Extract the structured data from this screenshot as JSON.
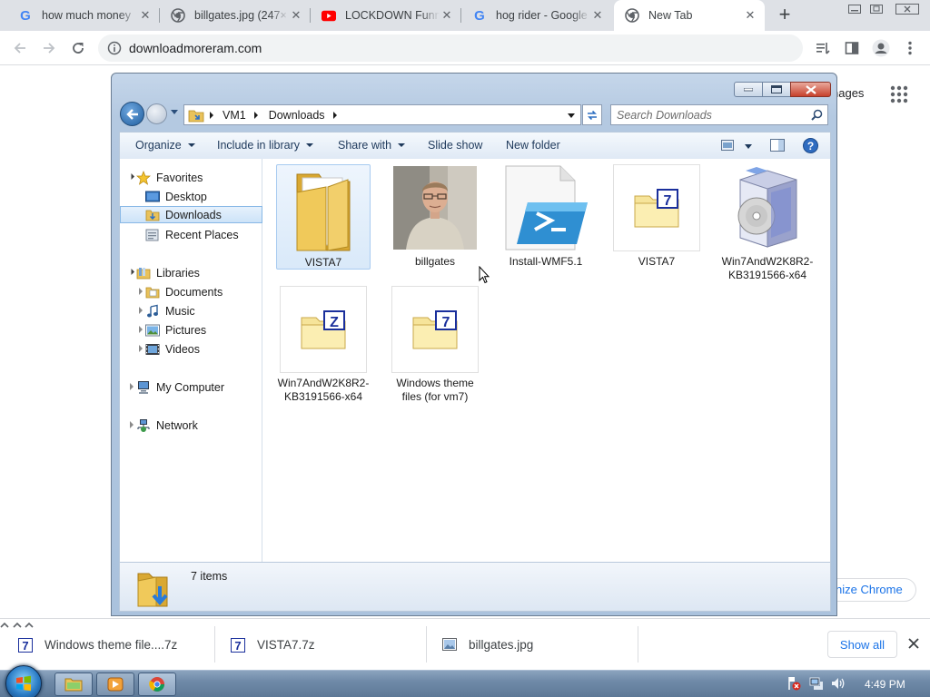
{
  "browser": {
    "tabs": [
      {
        "title": "how much money",
        "favicon": "google-icon"
      },
      {
        "title": "billgates.jpg (247×",
        "favicon": "chrome-icon"
      },
      {
        "title": "LOCKDOWN Funny",
        "favicon": "youtube-icon"
      },
      {
        "title": "hog rider - Google",
        "favicon": "google-icon"
      },
      {
        "title": "New Tab",
        "favicon": "chrome-icon",
        "active": true
      }
    ],
    "url": "downloadmoreram.com"
  },
  "newtab_page": {
    "images_link": "nages",
    "customize_button": "nize Chrome"
  },
  "explorer": {
    "breadcrumb": [
      "VM1",
      "Downloads"
    ],
    "search_placeholder": "Search Downloads",
    "commands": {
      "organize": "Organize",
      "include_in_library": "Include in library",
      "share_with": "Share with",
      "slide_show": "Slide show",
      "new_folder": "New folder"
    },
    "nav": {
      "favorites": "Favorites",
      "desktop": "Desktop",
      "downloads": "Downloads",
      "recent_places": "Recent Places",
      "libraries": "Libraries",
      "documents": "Documents",
      "music": "Music",
      "pictures": "Pictures",
      "videos": "Videos",
      "my_computer": "My Computer",
      "network": "Network"
    },
    "files": [
      {
        "name": "VISTA7",
        "icon": "folder-icon"
      },
      {
        "name": "billgates",
        "icon": "photo-thumbnail"
      },
      {
        "name": "Install-WMF5.1",
        "icon": "powershell-icon"
      },
      {
        "name": "VISTA7",
        "icon": "7z-archive-icon"
      },
      {
        "name": "Win7AndW2K8R2-KB3191566-x64",
        "icon": "installer-box-icon"
      },
      {
        "name": "Win7AndW2K8R2-KB3191566-x64",
        "icon": "zip-archive-icon"
      },
      {
        "name": "Windows theme files (for vm7)",
        "icon": "7z-archive-icon"
      }
    ],
    "item_count": "7 items"
  },
  "downloads_shelf": {
    "items": [
      {
        "name": "Windows theme file....7z",
        "icon": "7z-file-icon"
      },
      {
        "name": "VISTA7.7z",
        "icon": "7z-file-icon"
      },
      {
        "name": "billgates.jpg",
        "icon": "image-file-icon"
      }
    ],
    "show_all": "Show all"
  },
  "taskbar": {
    "clock": "4:49 PM"
  }
}
